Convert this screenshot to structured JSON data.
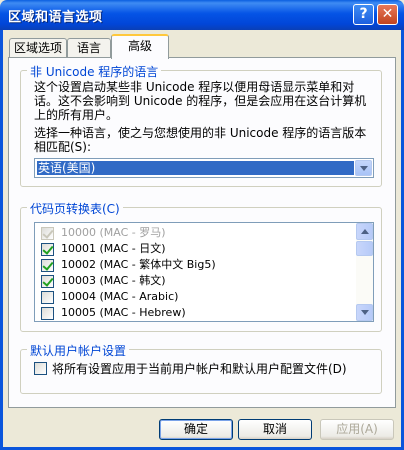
{
  "window": {
    "title": "区域和语言选项",
    "help_label": "?",
    "close_label": "✕"
  },
  "tabs": [
    {
      "label": "区域选项",
      "active": false
    },
    {
      "label": "语言",
      "active": false
    },
    {
      "label": "高级",
      "active": true
    }
  ],
  "non_unicode": {
    "legend": "非 Unicode 程序的语言",
    "description": "这个设置启动某些非 Unicode 程序以便用母语显示菜单和对话。这不会影响到 Unicode 的程序，但是会应用在这台计算机上的所有用户。",
    "choose_label": "选择一种语言，使之与您想使用的非 Unicode 程序的语言版本相匹配(S):",
    "selected_language": "英语(美国)"
  },
  "code_pages": {
    "legend": "代码页转换表(C)",
    "items": [
      {
        "label": "10000 (MAC - 罗马)",
        "checked": true,
        "enabled": false
      },
      {
        "label": "10001 (MAC - 日文)",
        "checked": true,
        "enabled": true
      },
      {
        "label": "10002 (MAC - 繁体中文 Big5)",
        "checked": true,
        "enabled": true
      },
      {
        "label": "10003 (MAC - 韩文)",
        "checked": true,
        "enabled": true
      },
      {
        "label": "10004 (MAC - Arabic)",
        "checked": false,
        "enabled": true
      },
      {
        "label": "10005 (MAC - Hebrew)",
        "checked": false,
        "enabled": true
      }
    ]
  },
  "default_user": {
    "legend": "默认用户帐户设置",
    "apply_label": "将所有设置应用于当前用户帐户和默认用户配置文件(D)"
  },
  "buttons": {
    "ok": "确定",
    "cancel": "取消",
    "apply": "应用(A)"
  },
  "colors": {
    "selection": "#316ac5",
    "title_blue": "#0554e6",
    "group_label": "#0046d5"
  }
}
